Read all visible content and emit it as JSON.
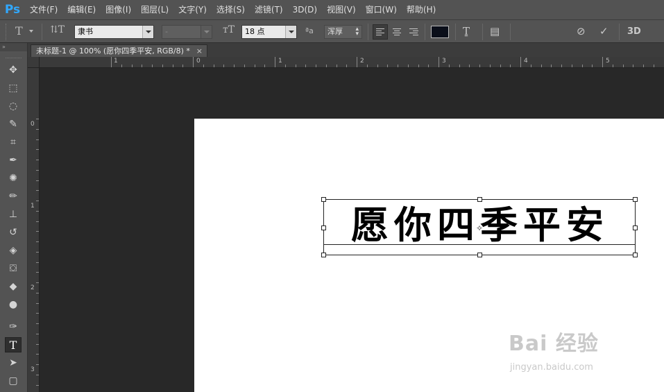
{
  "app": {
    "logo": "Ps",
    "menu": [
      "文件(F)",
      "编辑(E)",
      "图像(I)",
      "图层(L)",
      "文字(Y)",
      "选择(S)",
      "滤镜(T)",
      "3D(D)",
      "视图(V)",
      "窗口(W)",
      "帮助(H)"
    ]
  },
  "options": {
    "tool_icon": "T",
    "font_family": "隶书",
    "font_style": "-",
    "font_size": "18 点",
    "aa_icon": "ªa",
    "antialias": "浑厚",
    "text_color": "#0b0f1a",
    "three_d": "3D"
  },
  "document": {
    "tab_title": "未标题-1 @ 100% (愿你四季平安, RGB/8) *",
    "close_glyph": "×",
    "layer_text": "愿你四季平安"
  },
  "rulers": {
    "horizontal": [
      "1",
      "0",
      "1",
      "2",
      "3",
      "4",
      "5"
    ],
    "vertical": [
      "0",
      "1",
      "2",
      "3"
    ]
  },
  "tools": {
    "header": "»",
    "icons": [
      "move-icon",
      "marquee-icon",
      "lasso-icon",
      "quick-select-icon",
      "crop-icon",
      "eyedropper-icon",
      "healing-icon",
      "brush-icon",
      "stamp-icon",
      "history-brush-icon",
      "eraser-icon",
      "bucket-icon",
      "blur-icon",
      "dodge-icon",
      "pen-icon",
      "type-icon",
      "path-select-icon",
      "shape-icon"
    ],
    "active": "type-icon"
  },
  "watermark": {
    "brand": "Bai 经验",
    "url": "jingyan.baidu.com"
  }
}
